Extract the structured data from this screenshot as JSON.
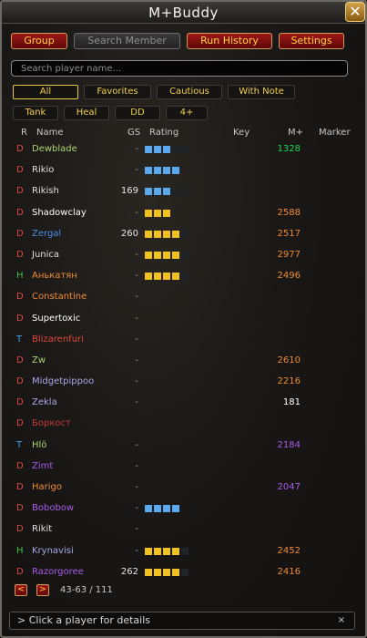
{
  "window": {
    "title": "M+Buddy",
    "close_label": "✕"
  },
  "top_buttons": [
    {
      "label": "Group",
      "disabled": false
    },
    {
      "label": "Search Member",
      "disabled": true
    },
    {
      "label": "Run History",
      "disabled": false
    },
    {
      "label": "Settings",
      "disabled": false
    }
  ],
  "search": {
    "placeholder": "Search player name..."
  },
  "filters_row1": [
    {
      "label": "All",
      "active": true
    },
    {
      "label": "Favorites",
      "active": false
    },
    {
      "label": "Cautious",
      "active": false
    },
    {
      "label": "With Note",
      "active": false
    }
  ],
  "filters_row2": [
    {
      "label": "Tank",
      "active": false
    },
    {
      "label": "Heal",
      "active": false
    },
    {
      "label": "DD",
      "active": false
    },
    {
      "label": "4+",
      "active": false
    }
  ],
  "columns": {
    "role": "R",
    "name": "Name",
    "gs": "GS",
    "rating": "Rating",
    "key": "Key",
    "mplus": "M+",
    "marker": "Marker"
  },
  "colors": {
    "role_D": "#e04a3a",
    "role_H": "#3ec24a",
    "role_T": "#4aa0e8",
    "rating_blue": "#5aa8ee",
    "rating_yellow": "#f1c21f",
    "rating_empty": "#1f2428",
    "score_green": "#22d44a",
    "score_orange": "#f08a34",
    "score_white": "#ffffff",
    "score_purple": "#a85ae8"
  },
  "players": [
    {
      "role": "D",
      "name": "Dewblade",
      "name_color": "#abd473",
      "gs": "-",
      "rating": {
        "filled": 3,
        "of": 5,
        "color": "blue"
      },
      "mplus": "1328",
      "mplus_color": "#22d44a"
    },
    {
      "role": "D",
      "name": "Rikio",
      "name_color": "#e0e0e0",
      "gs": "-",
      "rating": {
        "filled": 4,
        "of": 4,
        "color": "blue"
      },
      "mplus": "",
      "mplus_color": ""
    },
    {
      "role": "D",
      "name": "Rikish",
      "name_color": "#e0e0e0",
      "gs": "169",
      "rating": {
        "filled": 3,
        "of": 5,
        "color": "blue"
      },
      "mplus": "",
      "mplus_color": ""
    },
    {
      "role": "D",
      "name": "Shadowclay",
      "name_color": "#ffffff",
      "gs": "-",
      "rating": {
        "filled": 3,
        "of": 3,
        "color": "yellow"
      },
      "mplus": "2588",
      "mplus_color": "#f08a34"
    },
    {
      "role": "D",
      "name": "Zergal",
      "name_color": "#4a8fe8",
      "gs": "260",
      "rating": {
        "filled": 4,
        "of": 5,
        "color": "yellow"
      },
      "mplus": "2517",
      "mplus_color": "#f08a34"
    },
    {
      "role": "D",
      "name": "Junica",
      "name_color": "#e0e0e0",
      "gs": "-",
      "rating": {
        "filled": 4,
        "of": 5,
        "color": "yellow"
      },
      "mplus": "2977",
      "mplus_color": "#f08a34"
    },
    {
      "role": "H",
      "name": "Анькатян",
      "name_color": "#f08a34",
      "gs": "-",
      "rating": {
        "filled": 4,
        "of": 5,
        "color": "yellow"
      },
      "mplus": "2496",
      "mplus_color": "#f08a34"
    },
    {
      "role": "D",
      "name": "Constantine",
      "name_color": "#f08a34",
      "gs": "-",
      "rating": {
        "filled": 0,
        "of": 0,
        "color": "blue"
      },
      "mplus": "",
      "mplus_color": ""
    },
    {
      "role": "D",
      "name": "Supertoxic",
      "name_color": "#ffffff",
      "gs": "-",
      "rating": {
        "filled": 0,
        "of": 0,
        "color": "blue"
      },
      "mplus": "",
      "mplus_color": ""
    },
    {
      "role": "T",
      "name": "Blizarenfuri",
      "name_color": "#e04a3a",
      "gs": "-",
      "rating": {
        "filled": 0,
        "of": 0,
        "color": "blue"
      },
      "mplus": "",
      "mplus_color": ""
    },
    {
      "role": "D",
      "name": "Zw",
      "name_color": "#abd473",
      "gs": "-",
      "rating": {
        "filled": 0,
        "of": 0,
        "color": "blue"
      },
      "mplus": "2610",
      "mplus_color": "#f08a34"
    },
    {
      "role": "D",
      "name": "Midgetpippoo",
      "name_color": "#a8a8e8",
      "gs": "-",
      "rating": {
        "filled": 0,
        "of": 0,
        "color": "blue"
      },
      "mplus": "2216",
      "mplus_color": "#f08a34"
    },
    {
      "role": "D",
      "name": "Zekla",
      "name_color": "#a8a8e8",
      "gs": "-",
      "rating": {
        "filled": 0,
        "of": 0,
        "color": "blue"
      },
      "mplus": "181",
      "mplus_color": "#ffffff"
    },
    {
      "role": "D",
      "name": "Боркост",
      "name_color": "#c83a3a",
      "gs": "",
      "rating": {
        "filled": 0,
        "of": 0,
        "color": "blue"
      },
      "mplus": "",
      "mplus_color": ""
    },
    {
      "role": "T",
      "name": "Hlö",
      "name_color": "#abd473",
      "gs": "-",
      "rating": {
        "filled": 0,
        "of": 0,
        "color": "blue"
      },
      "mplus": "2184",
      "mplus_color": "#a85ae8"
    },
    {
      "role": "D",
      "name": "Zimt",
      "name_color": "#a85ae8",
      "gs": "-",
      "rating": {
        "filled": 0,
        "of": 0,
        "color": "blue"
      },
      "mplus": "",
      "mplus_color": ""
    },
    {
      "role": "D",
      "name": "Harigo",
      "name_color": "#f08a34",
      "gs": "-",
      "rating": {
        "filled": 0,
        "of": 0,
        "color": "blue"
      },
      "mplus": "2047",
      "mplus_color": "#a85ae8"
    },
    {
      "role": "D",
      "name": "Bobobow",
      "name_color": "#a85ae8",
      "gs": "-",
      "rating": {
        "filled": 4,
        "of": 4,
        "color": "blue"
      },
      "mplus": "",
      "mplus_color": ""
    },
    {
      "role": "D",
      "name": "Rikit",
      "name_color": "#e0e0e0",
      "gs": "-",
      "rating": {
        "filled": 0,
        "of": 0,
        "color": "blue"
      },
      "mplus": "",
      "mplus_color": ""
    },
    {
      "role": "H",
      "name": "Krynavisi",
      "name_color": "#a8a8e8",
      "gs": "-",
      "rating": {
        "filled": 4,
        "of": 5,
        "color": "yellow"
      },
      "mplus": "2452",
      "mplus_color": "#f08a34"
    },
    {
      "role": "D",
      "name": "Razorgoree",
      "name_color": "#a85ae8",
      "gs": "262",
      "rating": {
        "filled": 4,
        "of": 5,
        "color": "yellow"
      },
      "mplus": "2416",
      "mplus_color": "#f08a34"
    }
  ],
  "pagination": {
    "prev": "<",
    "next": ">",
    "range": "43-63 / 111"
  },
  "status": {
    "text": "> Click a player for details",
    "close": "×"
  }
}
